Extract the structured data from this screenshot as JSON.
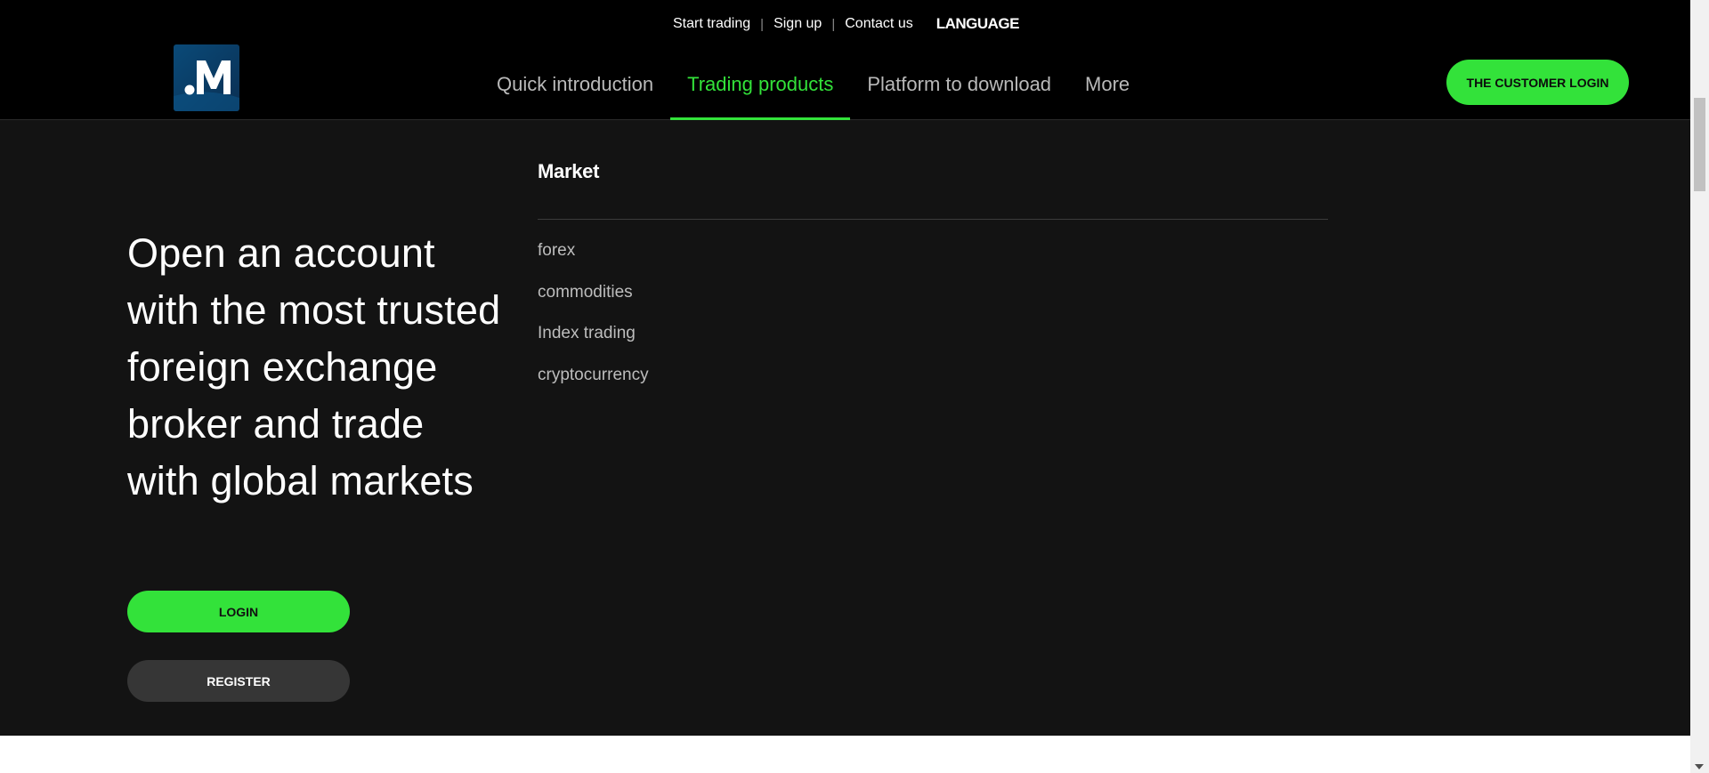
{
  "topbar": {
    "links": [
      "Start trading",
      "Sign up",
      "Contact us"
    ],
    "separator": "|",
    "language": "LANGUAGE"
  },
  "logo": {
    "icon": "m-logo-icon"
  },
  "nav": {
    "items": [
      {
        "label": "Quick introduction",
        "active": false
      },
      {
        "label": "Trading products",
        "active": true
      },
      {
        "label": "Platform to download",
        "active": false
      },
      {
        "label": "More",
        "active": false
      }
    ],
    "customer_login": "THE CUSTOMER LOGIN"
  },
  "hero": {
    "heading": "Open an account with the most trusted foreign exchange broker and trade with global markets",
    "login": "LOGIN",
    "register": "REGISTER"
  },
  "menu": {
    "title": "Market",
    "items": [
      "forex",
      "commodities",
      "Index trading",
      "cryptocurrency"
    ]
  },
  "colors": {
    "accent": "#33e23a",
    "background": "#131313",
    "header": "#000000",
    "logo": "#0a4a78"
  }
}
